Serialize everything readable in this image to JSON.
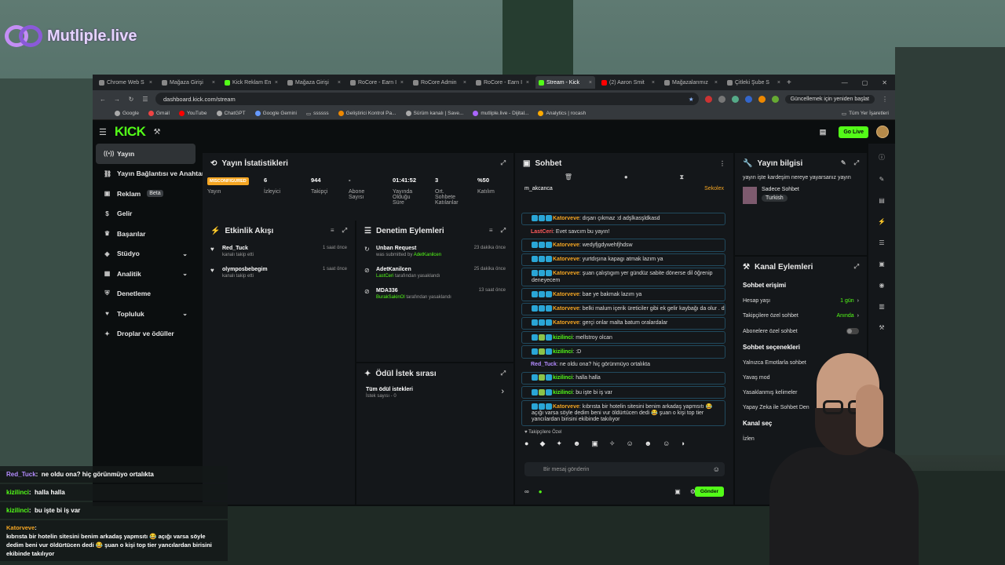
{
  "overlay_logo": {
    "text": "Mutliple.live"
  },
  "browser": {
    "tabs": [
      {
        "label": "Chrome Web S"
      },
      {
        "label": "Mağaza Girişi"
      },
      {
        "label": "Kick Reklam En"
      },
      {
        "label": "Mağaza Girişi"
      },
      {
        "label": "RoCore - Earn I"
      },
      {
        "label": "RoCore Admin"
      },
      {
        "label": "RoCore - Earn I"
      },
      {
        "label": "Stream - Kick",
        "active": true
      },
      {
        "label": "(2) Aaron Smit"
      },
      {
        "label": "Mağazalarımız"
      },
      {
        "label": "Çitleki Şube S"
      }
    ],
    "new_tab": "+",
    "url": "dashboard.kick.com/stream",
    "update_label": "Güncellemek için yeniden başlat",
    "bookmarks": [
      "Google",
      "Gmail",
      "YouTube",
      "ChatGPT",
      "Google Gemini",
      "ssssss",
      "Geliştirici Kontrol Pa...",
      "Sürüm kanalı | Save...",
      "mutliple.live - Dijital...",
      "Analytics | rocash"
    ],
    "bookmarks_right": "Tüm Yer İşaretleri"
  },
  "kick": {
    "logo": "KICK",
    "golive": "Go Live",
    "sidebar": [
      {
        "label": "Yayın",
        "icon": "broadcast-icon",
        "active": true
      },
      {
        "label": "Yayın Bağlantısı ve Anahtarı",
        "icon": "link-icon"
      },
      {
        "label": "Reklam",
        "icon": "ad-icon",
        "badge": "Beta"
      },
      {
        "label": "Gelir",
        "icon": "money-icon"
      },
      {
        "label": "Başarılar",
        "icon": "trophy-icon"
      },
      {
        "label": "Stüdyo",
        "icon": "studio-icon",
        "chevron": true
      },
      {
        "label": "Analitik",
        "icon": "chart-icon",
        "chevron": true
      },
      {
        "label": "Denetleme",
        "icon": "shield-icon"
      },
      {
        "label": "Topluluk",
        "icon": "community-icon",
        "chevron": true
      },
      {
        "label": "Droplar ve ödüller",
        "icon": "gift-icon"
      }
    ],
    "stats": {
      "title": "Yayın İstatistikleri",
      "items": [
        {
          "value": "MISCONFIGURED",
          "label": "Yayın"
        },
        {
          "value": "6",
          "label": "İzleyici"
        },
        {
          "value": "944",
          "label": "Takipçi"
        },
        {
          "value": "-",
          "label": "Abone Sayısı"
        },
        {
          "value": "01:41:52",
          "label": "Yayında Olduğu Süre"
        },
        {
          "value": "3",
          "label": "Ort. Sohbete Katılanlar"
        },
        {
          "value": "%50",
          "label": "Katılım"
        }
      ]
    },
    "activity": {
      "title": "Etkinlik Akışı",
      "items": [
        {
          "name": "Red_Tuck",
          "sub": "kanalı takip etti",
          "time": "1 saat önce"
        },
        {
          "name": "olympos­bebegim",
          "sub": "kanalı takip etti",
          "time": "1 saat önce"
        }
      ]
    },
    "moderation": {
      "title": "Denetim Eylemleri",
      "items": [
        {
          "name": "Unban Request",
          "sub": "was submitted by",
          "who": "AdetKanilcen",
          "time": "23 dakika önce"
        },
        {
          "name": "AdetKanilcen",
          "sub": "tarafından yasaklandı",
          "who": "LastCeri",
          "time": "25 dakika önce"
        },
        {
          "name": "MDA336",
          "sub": "tarafından yasaklandı",
          "who": "BurakSakinOl",
          "time": "13 saat önce"
        }
      ]
    },
    "rewards": {
      "title": "Ödül İstek sırası",
      "all": "Tüm ödül istekleri",
      "count": "İstek sayısı - 0"
    },
    "chat": {
      "title": "Sohbet",
      "pinned_user": "m_akcanca",
      "pinned_right": "Sekolex",
      "messages": [
        {
          "user": "Katorveve",
          "color": "o",
          "text": "dışarı çıkmaz :d adşlkasşldkasd"
        },
        {
          "user": "LastCeri",
          "color": "r",
          "text": "Evet savcım bu yayın!",
          "plain": true
        },
        {
          "user": "Katorveve",
          "color": "o",
          "text": "wedyfjgdywehfjhdsw"
        },
        {
          "user": "Katorveve",
          "color": "o",
          "text": "yurtdışına kapagı atmak lazım ya"
        },
        {
          "user": "Katorveve",
          "color": "o",
          "text": "şuan çalıştıgım yer gündüz sabite dönerse dil öğrenip deneyecem"
        },
        {
          "user": "Katorveve",
          "color": "o",
          "text": "bae ye bakmak lazım ya"
        },
        {
          "user": "Katorveve",
          "color": "o",
          "text": "belki malum içerik üreticiler gibi ek gelir kaybağı da olur . d"
        },
        {
          "user": "Katorveve",
          "color": "o",
          "text": "gerçi onlar malta batum oralardalar"
        },
        {
          "user": "kizilinci",
          "color": "g",
          "text": "mellstroy olcan"
        },
        {
          "user": "kizilinci",
          "color": "g",
          "text": ":D"
        },
        {
          "user": "Red_Tuck",
          "color": "p",
          "text": "ne oldu ona? hiç görünmüyo ortalıkta",
          "plain": true
        },
        {
          "user": "kizilinci",
          "color": "g",
          "text": "halla halla"
        },
        {
          "user": "kizilinci",
          "color": "g",
          "text": "bu işte bi iş var"
        },
        {
          "user": "Katorveve",
          "color": "o",
          "text": "kıbrısta bir hotelin sitesini benim arkadaş yapmsıtı 😂 açığı varsa söyle dedim beni vur öldürtücen dedi 😂 şuan o kişi top tier yancılardan birisini ekibinde takılıyor"
        }
      ],
      "followers_label": "Takipçilere Özel",
      "input_placeholder": "Bir mesaj gönderin",
      "send": "Gönder"
    },
    "info": {
      "title": "Yayın bilgisi",
      "stream_title": "yayın işte kardeşim nereye yayarsanız yayın",
      "category": "Sadece Sohbet",
      "language": "Turkish"
    },
    "channel_actions": {
      "title": "Kanal Eylemleri",
      "chat_access": "Sohbet erişimi",
      "account_age": "Hesap yaşı",
      "account_age_val": "1 gün",
      "followers_only": "Takipçilere özel sohbet",
      "followers_only_val": "Anında",
      "subs_only": "Abonelere özel sohbet",
      "chat_options": "Sohbet seçenekleri",
      "emote_only": "Yalnızca Emotlarla sohbet",
      "slow": "Yavaş mod",
      "banned_words": "Yasaklanmış kelimeler",
      "ai": "Yapay Zeka ile Sohbet Den",
      "channel_more": "Kanal seç",
      "perms": "İzlen"
    }
  },
  "overlay_chat": [
    {
      "user": "Red_Tuck",
      "text": "ne oldu ona? hiç görünmüyo ortalıkta"
    },
    {
      "user": "kizilinci",
      "text": "halla halla"
    },
    {
      "user": "kizilinci",
      "text": "bu işte bi iş var"
    },
    {
      "user": "Katorveve",
      "text": "kıbrısta bir hotelin sitesini benim arkadaş yapmsıtı 😂 açığı varsa söyle dedim beni vur öldürtücen dedi 😂 şuan o kişi top tier yancılardan birisini ekibinde takılıyor"
    }
  ]
}
